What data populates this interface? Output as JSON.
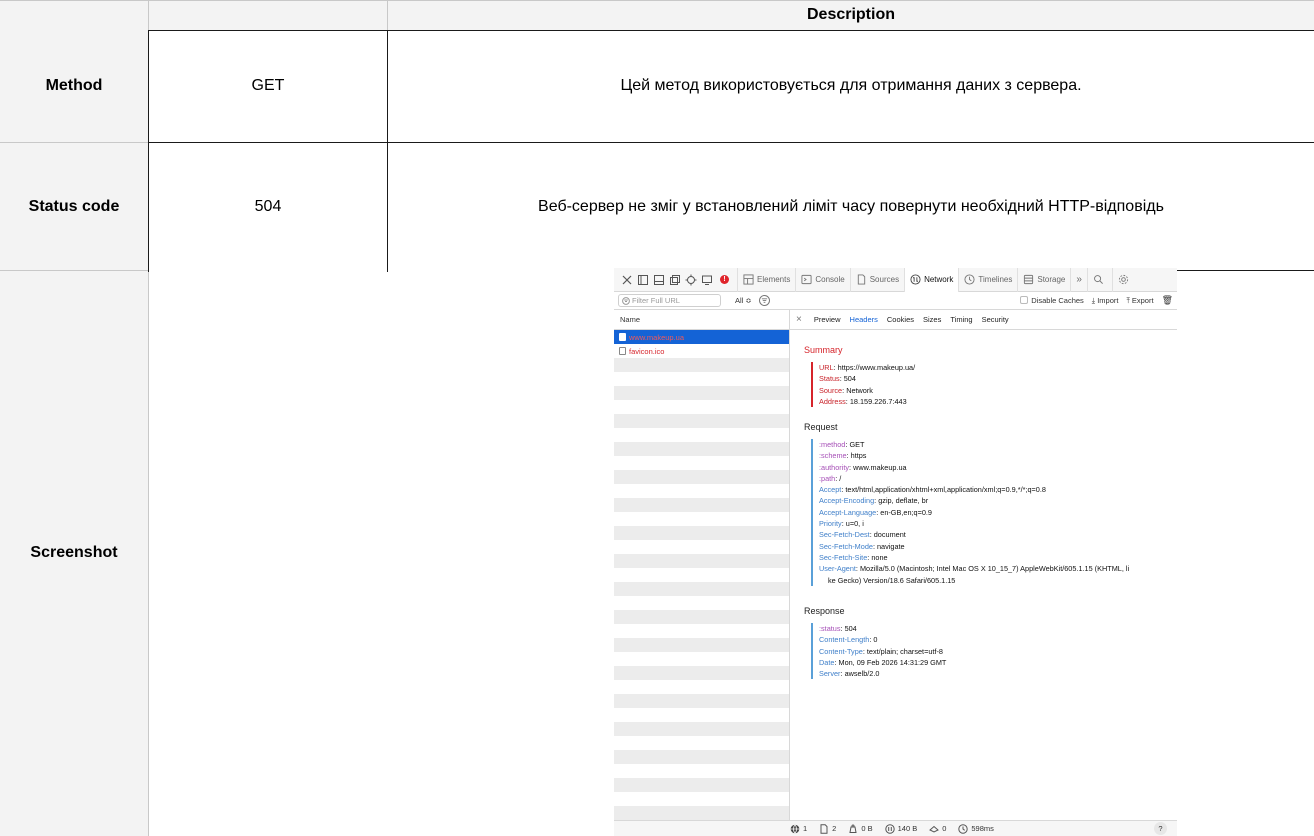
{
  "table": {
    "header_description": "Description",
    "rows": [
      {
        "label": "Method",
        "value": "GET",
        "description": "Цей метод використовується для отримання даних з сервера."
      },
      {
        "label": "Status code",
        "value": "504",
        "description": "Веб-сервер не зміг у встановлений ліміт часу повернути необхідний HTTP-відповідь"
      },
      {
        "label": "Screenshot"
      }
    ]
  },
  "devtools": {
    "tabs": [
      "Elements",
      "Console",
      "Sources",
      "Network",
      "Timelines",
      "Storage"
    ],
    "active_tab": "Network",
    "error_count": "!",
    "filter_placeholder": "Filter Full URL",
    "type_filter": "All ≎",
    "disable_caches": "Disable Caches",
    "import_label": "Import",
    "export_label": "Export",
    "list_header": "Name",
    "requests": [
      {
        "name": "www.makeup.ua",
        "selected": true
      },
      {
        "name": "favicon.ico",
        "selected": false
      }
    ],
    "detail_tabs": [
      "Preview",
      "Headers",
      "Cookies",
      "Sizes",
      "Timing",
      "Security"
    ],
    "active_detail_tab": "Headers",
    "summary": {
      "title": "Summary",
      "items": [
        {
          "key": "URL",
          "value": "https://www.makeup.ua/"
        },
        {
          "key": "Status",
          "value": "504"
        },
        {
          "key": "Source",
          "value": "Network"
        },
        {
          "key": "Address",
          "value": "18.159.226.7:443"
        }
      ]
    },
    "request": {
      "title": "Request",
      "items": [
        {
          "key": ":method",
          "value": "GET"
        },
        {
          "key": ":scheme",
          "value": "https"
        },
        {
          "key": ":authority",
          "value": "www.makeup.ua"
        },
        {
          "key": ":path",
          "value": "/"
        },
        {
          "key": "Accept",
          "value": "text/html,application/xhtml+xml,application/xml;q=0.9,*/*;q=0.8"
        },
        {
          "key": "Accept-Encoding",
          "value": "gzip, deflate, br"
        },
        {
          "key": "Accept-Language",
          "value": "en-GB,en;q=0.9"
        },
        {
          "key": "Priority",
          "value": "u=0, i"
        },
        {
          "key": "Sec-Fetch-Dest",
          "value": "document"
        },
        {
          "key": "Sec-Fetch-Mode",
          "value": "navigate"
        },
        {
          "key": "Sec-Fetch-Site",
          "value": "none"
        },
        {
          "key": "User-Agent",
          "value": "Mozilla/5.0 (Macintosh; Intel Mac OS X 10_15_7) AppleWebKit/605.1.15 (KHTML, li"
        },
        {
          "key": "",
          "value": "ke Gecko) Version/18.6 Safari/605.1.15"
        }
      ]
    },
    "response": {
      "title": "Response",
      "items": [
        {
          "key": ":status",
          "value": "504"
        },
        {
          "key": "Content-Length",
          "value": "0"
        },
        {
          "key": "Content-Type",
          "value": "text/plain; charset=utf-8"
        },
        {
          "key": "Date",
          "value": "Mon, 09 Feb 2026 14:31:29 GMT"
        },
        {
          "key": "Server",
          "value": "awselb/2.0"
        }
      ]
    },
    "status_bar": {
      "domains": "1",
      "resources": "2",
      "transferred": "0 B",
      "size": "140 B",
      "cached": "0",
      "time": "598ms",
      "help": "?"
    }
  }
}
